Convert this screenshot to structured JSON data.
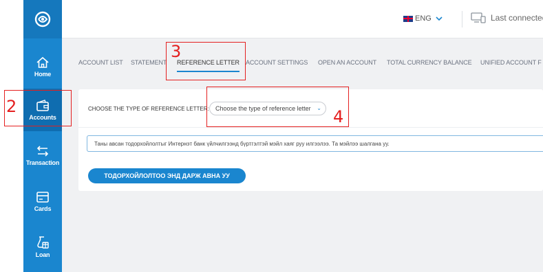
{
  "sidebar": {
    "logo_icon": "bank-logo-icon",
    "items": [
      {
        "label": "Home",
        "icon": "home-icon",
        "active": false
      },
      {
        "label": "Accounts",
        "icon": "wallet-icon",
        "active": true
      },
      {
        "label": "Transaction",
        "icon": "transfer-arrows-icon",
        "active": false
      },
      {
        "label": "Cards",
        "icon": "card-icon",
        "active": false
      },
      {
        "label": "Loan",
        "icon": "loan-icon",
        "active": false
      }
    ]
  },
  "topbar": {
    "language": "ENG",
    "language_icon": "uk-flag-icon",
    "last_connected": "Last connected"
  },
  "tabs": [
    {
      "label": "ACCOUNT LIST",
      "active": false
    },
    {
      "label": "STATEMENT",
      "active": false
    },
    {
      "label": "REFERENCE LETTER",
      "active": true
    },
    {
      "label": "ACCOUNT SETTINGS",
      "active": false
    },
    {
      "label": "OPEN AN ACCOUNT",
      "active": false
    },
    {
      "label": "TOTAL CURRENCY BALANCE",
      "active": false
    },
    {
      "label": "UNIFIED ACCOUNT F",
      "active": false
    }
  ],
  "reference": {
    "choose_label": "CHOOSE THE TYPE OF REFERENCE LETTER:",
    "select_value": "Choose the type of reference letter",
    "info_text": "Таны авсан тодорхойлолтыг Интернэт банк үйлчилгээнд бүртгэлтэй мэйл хаяг руу илгээлээ. Та мэйлээ шалгана уу.",
    "button_label": "ТОДОРХОЙЛОЛТОО ЭНД ДАРЖ АВНА УУ"
  },
  "annotations": [
    {
      "number": "2"
    },
    {
      "number": "3"
    },
    {
      "number": "4"
    }
  ],
  "colors": {
    "brand_blue": "#1a86cf",
    "sidebar_active": "#0f6db0",
    "annotation_red": "#e41f1f"
  }
}
